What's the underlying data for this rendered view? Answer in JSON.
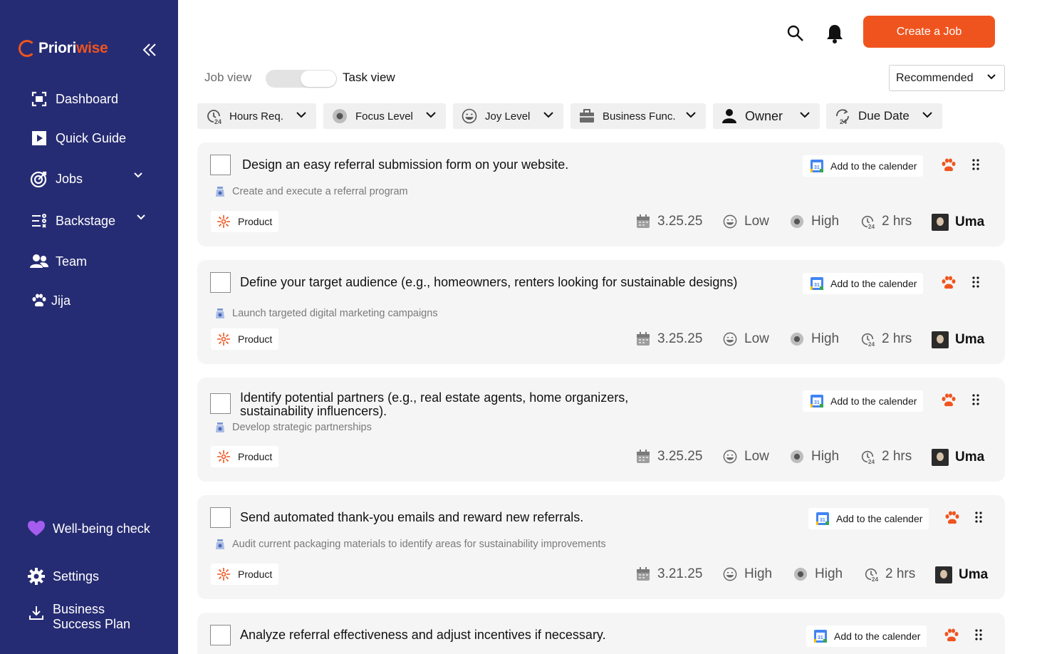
{
  "brand": {
    "name_part1": "Priori",
    "name_part2": "wise",
    "accent_color": "#f0541e",
    "sidebar_color": "#262c73"
  },
  "sidebar": {
    "collapse_icon": "double-chevron-left-icon",
    "items": [
      {
        "label": "Dashboard",
        "icon": "dashboard-icon"
      },
      {
        "label": "Quick Guide",
        "icon": "play-icon"
      },
      {
        "label": "Jobs",
        "icon": "target-icon",
        "expandable": true
      },
      {
        "label": "Backstage",
        "icon": "list-icon",
        "expandable": true
      },
      {
        "label": "Team",
        "icon": "team-icon"
      },
      {
        "label": "Jija",
        "icon": "paw-icon"
      }
    ],
    "bottom": [
      {
        "label": "Well-being check",
        "icon": "heart-icon"
      },
      {
        "label": "Settings",
        "icon": "gear-icon"
      },
      {
        "label_line1": "Business",
        "label_line2": "Success Plan",
        "icon": "download-icon"
      }
    ]
  },
  "header": {
    "create_label": "Create a Job",
    "job_view_label": "Job view",
    "task_view_label": "Task view",
    "sort_value": "Recommended"
  },
  "filters": [
    {
      "label": "Hours Req.",
      "icon": "clock-24-icon"
    },
    {
      "label": "Focus Level",
      "icon": "focus-dot-icon"
    },
    {
      "label": "Joy Level",
      "icon": "smiley-icon"
    },
    {
      "label": "Business Func.",
      "icon": "briefcase-icon"
    },
    {
      "label": "Owner",
      "icon": "person-icon"
    },
    {
      "label": "Due Date",
      "icon": "calendar-repeat-icon"
    }
  ],
  "tasks": [
    {
      "title": "Design an easy referral submission form on your website.",
      "job": "Create and execute a referral program",
      "calendar_label": "Add to the calender",
      "tag": "Product",
      "due": "3.25.25",
      "joy": "Low",
      "focus": "High",
      "hours": "2 hrs",
      "owner": "Uma"
    },
    {
      "title": "Define your target audience (e.g., homeowners, renters looking for sustainable designs)",
      "job": "Launch targeted digital marketing campaigns",
      "calendar_label": "Add to the calender",
      "tag": "Product",
      "due": "3.25.25",
      "joy": "Low",
      "focus": "High",
      "hours": "2 hrs",
      "owner": "Uma"
    },
    {
      "title": "Identify potential partners (e.g., real estate agents, home organizers, sustainability influencers).",
      "job": "Develop strategic partnerships",
      "calendar_label": "Add to the calender",
      "tag": "Product",
      "due": "3.25.25",
      "joy": "Low",
      "focus": "High",
      "hours": "2 hrs",
      "owner": "Uma"
    },
    {
      "title": "Send automated thank-you emails and reward new referrals.",
      "job": "Audit current packaging materials to identify areas for sustainability improvements",
      "calendar_label": "Add to the calender",
      "tag": "Product",
      "due": "3.21.25",
      "joy": "High",
      "focus": "High",
      "hours": "2 hrs",
      "owner": "Uma"
    },
    {
      "title": "Analyze referral effectiveness and adjust incentives if necessary.",
      "calendar_label": "Add to the calender"
    }
  ]
}
